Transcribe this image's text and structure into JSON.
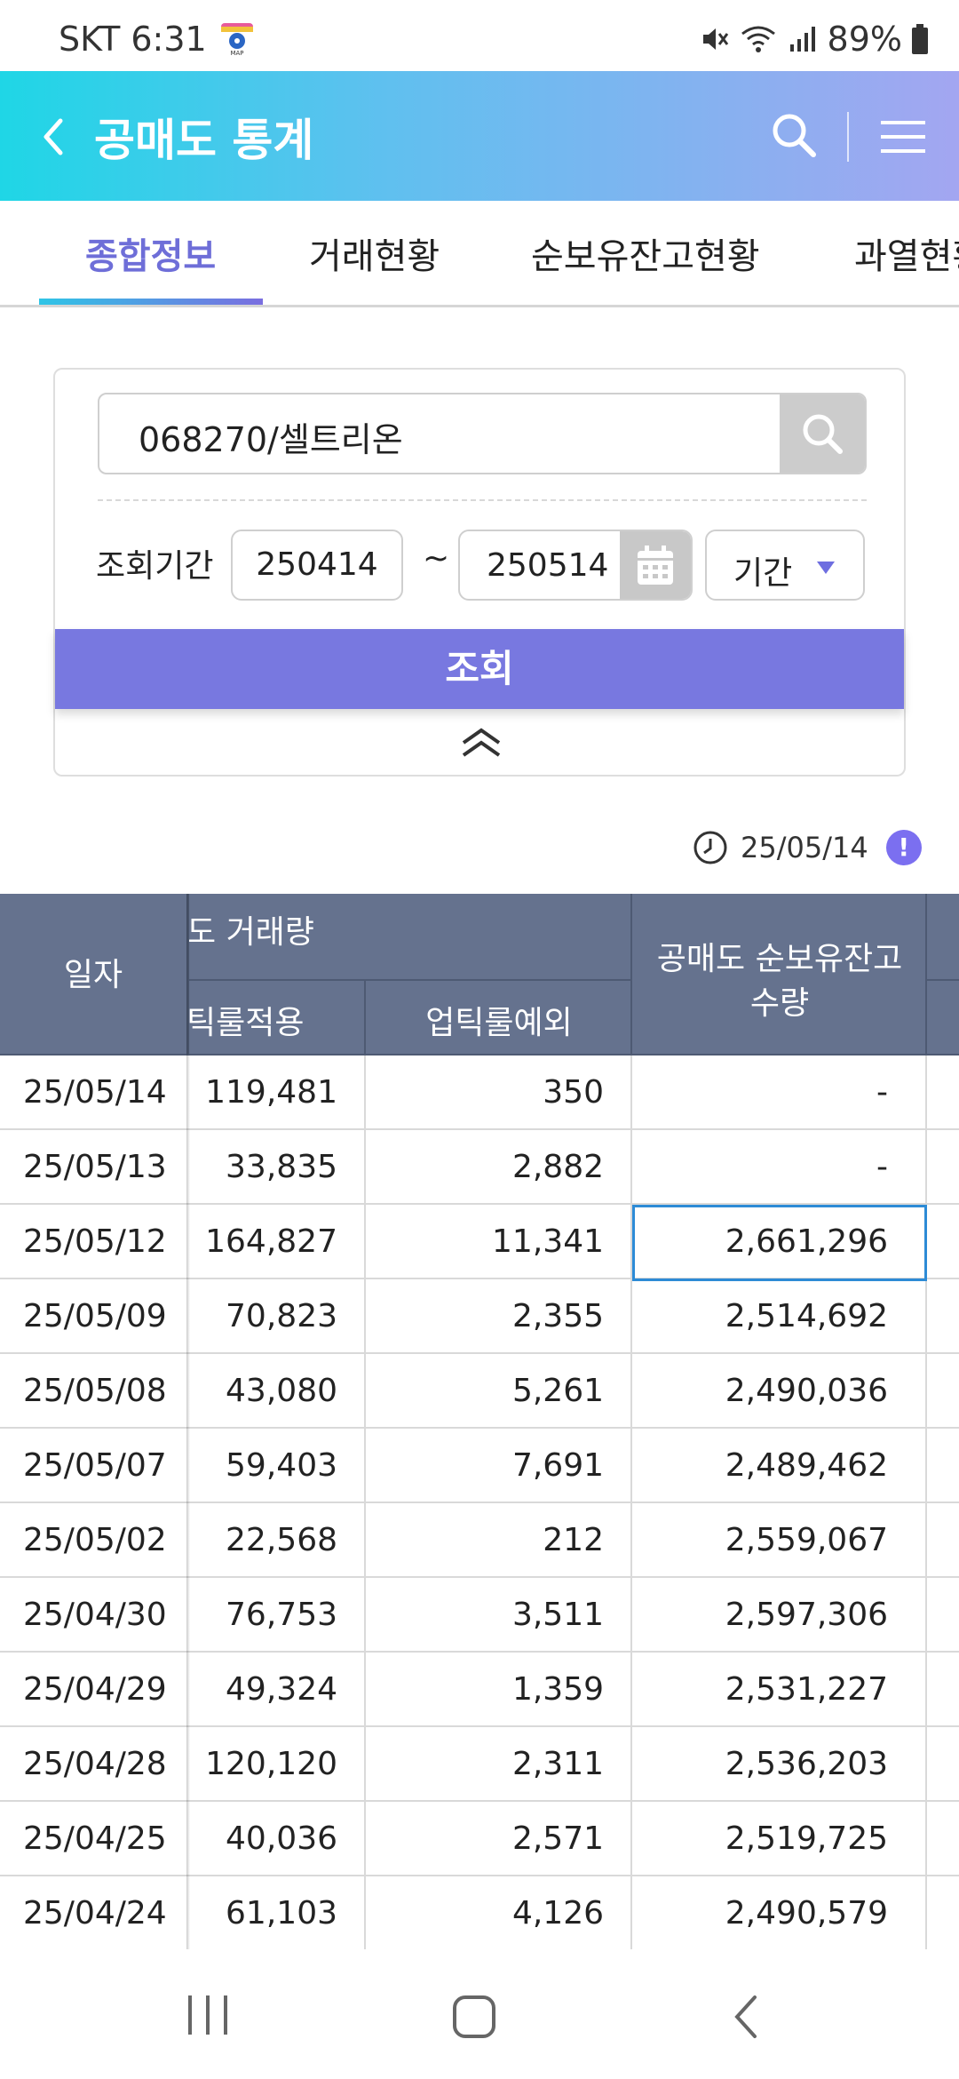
{
  "status_bar": {
    "carrier_time": "SKT 6:31",
    "battery": "89%",
    "icons": [
      "app-map-pin-icon",
      "mute-icon",
      "wifi-icon",
      "signal-icon",
      "battery-icon"
    ]
  },
  "header": {
    "title": "공매도 통계",
    "icons": [
      "back-icon",
      "search-icon",
      "menu-icon"
    ]
  },
  "tabs": [
    {
      "label": "종합정보",
      "active": true
    },
    {
      "label": "거래현황",
      "active": false
    },
    {
      "label": "순보유잔고현황",
      "active": false
    },
    {
      "label": "과열현황",
      "active": false
    }
  ],
  "search": {
    "stock_value": "068270/셀트리온",
    "period_label": "조회기간",
    "start_date": "250414",
    "separator": "~",
    "end_date": "250514",
    "period_select": "기간",
    "query_button": "조회"
  },
  "timestamp": {
    "date": "25/05/14",
    "info_glyph": "!"
  },
  "table": {
    "header": {
      "date": "일자",
      "group_volume": "도 거래량",
      "sub_applied": "틱룰적용",
      "sub_exception": "업틱룰예외",
      "balance_line1": "공매도 순보유잔고",
      "balance_line2": "수량"
    },
    "rows": [
      {
        "date": "25/05/14",
        "applied": "119,481",
        "exception": "350",
        "balance": "-"
      },
      {
        "date": "25/05/13",
        "applied": "33,835",
        "exception": "2,882",
        "balance": "-"
      },
      {
        "date": "25/05/12",
        "applied": "164,827",
        "exception": "11,341",
        "balance": "2,661,296"
      },
      {
        "date": "25/05/09",
        "applied": "70,823",
        "exception": "2,355",
        "balance": "2,514,692"
      },
      {
        "date": "25/05/08",
        "applied": "43,080",
        "exception": "5,261",
        "balance": "2,490,036"
      },
      {
        "date": "25/05/07",
        "applied": "59,403",
        "exception": "7,691",
        "balance": "2,489,462"
      },
      {
        "date": "25/05/02",
        "applied": "22,568",
        "exception": "212",
        "balance": "2,559,067"
      },
      {
        "date": "25/04/30",
        "applied": "76,753",
        "exception": "3,511",
        "balance": "2,597,306"
      },
      {
        "date": "25/04/29",
        "applied": "49,324",
        "exception": "1,359",
        "balance": "2,531,227"
      },
      {
        "date": "25/04/28",
        "applied": "120,120",
        "exception": "2,311",
        "balance": "2,536,203"
      },
      {
        "date": "25/04/25",
        "applied": "40,036",
        "exception": "2,571",
        "balance": "2,519,725"
      },
      {
        "date": "25/04/24",
        "applied": "61,103",
        "exception": "4,126",
        "balance": "2,490,579"
      }
    ],
    "selected_row": 2
  },
  "colors": {
    "accent": "#7878e0",
    "header_gradient_start": "#1fd6e6",
    "header_gradient_end": "#a3a6f1",
    "table_header": "#65728e",
    "selection_border": "#2d8bd6"
  }
}
